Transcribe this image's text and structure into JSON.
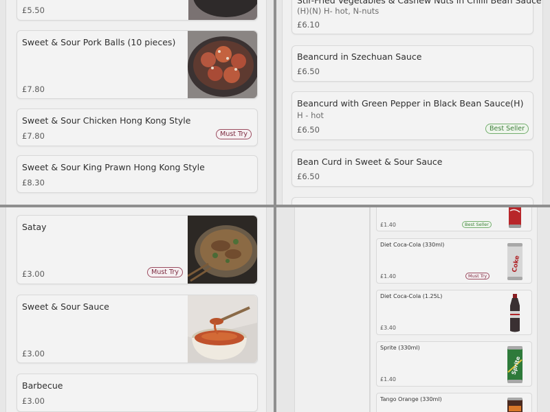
{
  "top_left": {
    "partial_price": "£5.50",
    "items": [
      {
        "title": "Sweet & Sour Pork Balls (10 pieces)",
        "price": "£7.80",
        "badge": "",
        "image": "pork-balls-photo"
      },
      {
        "title": "Sweet & Sour Chicken Hong Kong Style",
        "price": "£7.80",
        "badge": "Must Try"
      },
      {
        "title": "Sweet & Sour King Prawn Hong Kong Style",
        "price": "£8.30",
        "badge": ""
      }
    ]
  },
  "top_right": {
    "partial_title": "Stir-Fried Vegetables & Cashew Nuts in Chilli Bean Sauce",
    "partial_subtitle": "(H)(N) H- hot, N-nuts",
    "partial_price": "£6.10",
    "items": [
      {
        "title": "Beancurd in Szechuan Sauce",
        "subtitle": "",
        "price": "£6.50",
        "badge": ""
      },
      {
        "title": "Beancurd with Green Pepper in Black Bean Sauce(H)",
        "subtitle": "H - hot",
        "price": "£6.50",
        "badge": "Best Seller"
      },
      {
        "title": "Bean Curd in Sweet & Sour Sauce",
        "subtitle": "",
        "price": "£6.50",
        "badge": ""
      }
    ]
  },
  "bottom_left": {
    "items": [
      {
        "title": "Satay",
        "price": "£3.00",
        "badge": "Must Try",
        "image": "satay-photo"
      },
      {
        "title": "Sweet & Sour Sauce",
        "price": "£3.00",
        "badge": "",
        "image": "sauce-photo"
      },
      {
        "title": "Barbecue",
        "price": "£3.00",
        "badge": ""
      }
    ]
  },
  "bottom_right": {
    "drinks": [
      {
        "title": "",
        "price": "£1.40",
        "badge": "Best Seller",
        "image": "coca-cola-can"
      },
      {
        "title": "Diet Coca-Cola (330ml)",
        "price": "£1.40",
        "badge": "Must Try",
        "image": "diet-coke-can"
      },
      {
        "title": "Diet Coca-Cola (1.25L)",
        "price": "£3.40",
        "badge": "",
        "image": "diet-coke-bottle"
      },
      {
        "title": "Sprite (330ml)",
        "price": "£1.40",
        "badge": "",
        "image": "sprite-can"
      },
      {
        "title": "Tango Orange (330ml)",
        "price": "",
        "badge": "",
        "image": "tango-can"
      }
    ],
    "can_labels": {
      "coke": "Coke",
      "sprite": "Sprite"
    }
  },
  "colors": {
    "overlay": "#8f8f8f",
    "must_try": "#7b2a3f",
    "best_seller": "#3e7f3a"
  }
}
